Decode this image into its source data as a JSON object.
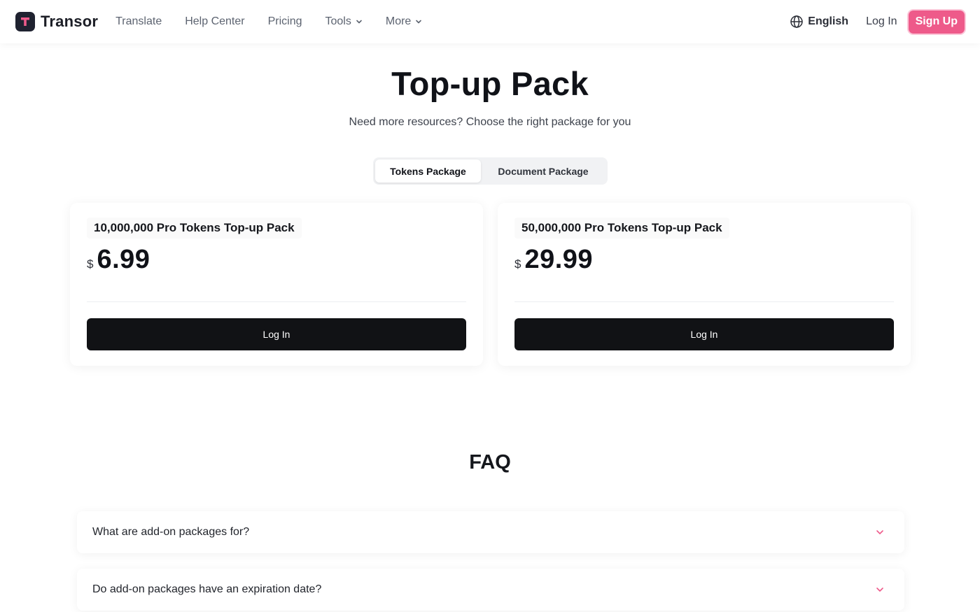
{
  "nav": {
    "brand": "Transor",
    "brand_logo_letter": "T",
    "links": [
      "Translate",
      "Help Center",
      "Pricing",
      "Tools",
      "More"
    ],
    "language": "English",
    "login": "Log In",
    "signup": "Sign Up"
  },
  "hero": {
    "title": "Top-up Pack",
    "subtitle": "Need more resources? Choose the right package for you",
    "tabs": [
      {
        "label": "Tokens Package",
        "active": true
      },
      {
        "label": "Document Package",
        "active": false
      }
    ]
  },
  "packages": [
    {
      "name": "10,000,000 Pro Tokens Top-up Pack",
      "currency": "$",
      "price": "6.99",
      "button": "Log In"
    },
    {
      "name": "50,000,000 Pro Tokens Top-up Pack",
      "currency": "$",
      "price": "29.99",
      "button": "Log In"
    }
  ],
  "faq": {
    "title": "FAQ",
    "items": [
      {
        "question": "What are add-on packages for?"
      },
      {
        "question": "Do add-on packages have an expiration date?"
      }
    ]
  },
  "colors": {
    "accent": "#ee5a8a",
    "button_dark": "#111215",
    "logo_bg": "#1f2230"
  },
  "icons": {
    "language": "globe-icon",
    "dropdown": "chevron-down-icon",
    "faq_toggle": "chevron-down-icon"
  }
}
